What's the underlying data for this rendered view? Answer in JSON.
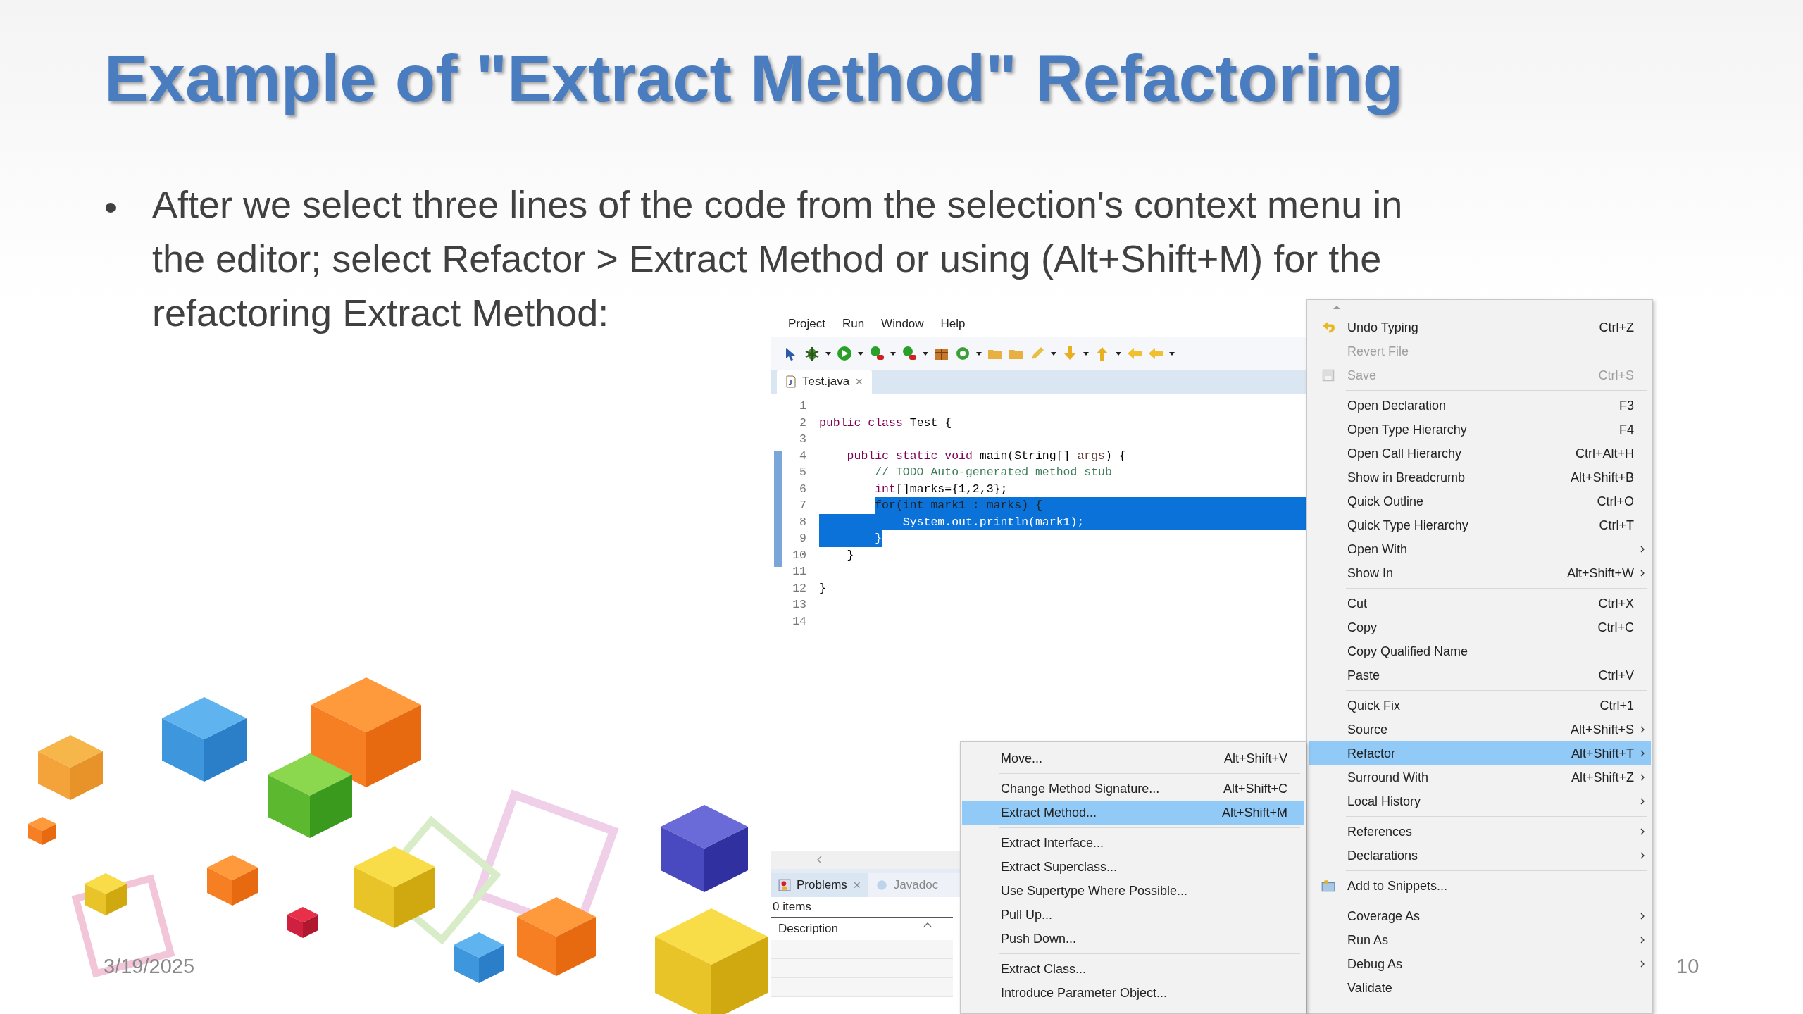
{
  "slide": {
    "title": "Example of \"Extract Method\" Refactoring",
    "bullet_lines": [
      "After we select three lines of the code from the selection's context menu in",
      "the editor; select Refactor > Extract Method or using (Alt+Shift+M) for the",
      "refactoring Extract Method:"
    ],
    "date": "3/19/2025",
    "page_number": "10"
  },
  "eclipse": {
    "menubar": [
      "Project",
      "Run",
      "Window",
      "Help"
    ],
    "editor_tab": {
      "label": "Test.java",
      "close": "✕"
    },
    "code_lines": [
      {
        "number": "1"
      },
      {
        "number": "2",
        "segments": [
          {
            "text": "public class",
            "kind": "keyword",
            "selected": false
          },
          {
            "text": " Test {",
            "kind": "plain",
            "selected": false
          }
        ]
      },
      {
        "number": "3"
      },
      {
        "number": "4",
        "segments": [
          {
            "text": "    public static void",
            "kind": "keyword",
            "selected": false
          },
          {
            "text": " main(String[] ",
            "kind": "plain",
            "selected": false
          },
          {
            "text": "args",
            "kind": "param",
            "selected": false
          },
          {
            "text": ") {",
            "kind": "plain",
            "selected": false
          }
        ]
      },
      {
        "number": "5",
        "segments": [
          {
            "text": "        // TODO Auto-generated method stub",
            "kind": "comment",
            "selected": false
          }
        ]
      },
      {
        "number": "6",
        "segments": [
          {
            "text": "        int",
            "kind": "keyword",
            "selected": false
          },
          {
            "text": "[]marks={1,2,3};",
            "kind": "plain",
            "selected": false
          }
        ]
      },
      {
        "number": "7",
        "selection_to_end": true,
        "indent_selected": false,
        "segments": [
          {
            "text": "        for(int mark1 : marks) {",
            "selected": true
          }
        ]
      },
      {
        "number": "8",
        "selection_to_end": true,
        "indent_selected": true,
        "segments": [
          {
            "text": "            System.out.println(mark1);",
            "selected": true
          }
        ]
      },
      {
        "number": "9",
        "selection_to_end": false,
        "indent_selected": true,
        "segments": [
          {
            "text": "        }",
            "selected": true
          }
        ]
      },
      {
        "number": "10",
        "segments": [
          {
            "text": "    }",
            "kind": "plain",
            "selected": false
          }
        ]
      },
      {
        "number": "11"
      },
      {
        "number": "12",
        "segments": [
          {
            "text": "}",
            "kind": "plain",
            "selected": false
          }
        ]
      },
      {
        "number": "13"
      },
      {
        "number": "14"
      }
    ],
    "bottom_panel": {
      "tabs": [
        {
          "label": "Problems",
          "selected": true
        },
        {
          "label": "Javadoc",
          "selected": false
        }
      ],
      "count": "0 items",
      "column": "Description"
    },
    "context_menu": [
      [
        {
          "label": "Undo Typing",
          "shortcut": "Ctrl+Z",
          "kind": "undo",
          "disabled": false,
          "selected": false,
          "submenu": false
        },
        {
          "label": "Revert File",
          "kind": "plain",
          "disabled": true,
          "selected": false,
          "submenu": false
        },
        {
          "label": "Save",
          "shortcut": "Ctrl+S",
          "kind": "save",
          "disabled": true,
          "selected": false,
          "submenu": false
        }
      ],
      [
        {
          "label": "Open Declaration",
          "shortcut": "F3",
          "kind": "plain",
          "disabled": false,
          "selected": false,
          "submenu": false
        },
        {
          "label": "Open Type Hierarchy",
          "shortcut": "F4",
          "kind": "plain",
          "disabled": false,
          "selected": false,
          "submenu": false
        },
        {
          "label": "Open Call Hierarchy",
          "shortcut": "Ctrl+Alt+H",
          "kind": "plain",
          "disabled": false,
          "selected": false,
          "submenu": false
        },
        {
          "label": "Show in Breadcrumb",
          "shortcut": "Alt+Shift+B",
          "kind": "plain",
          "disabled": false,
          "selected": false,
          "submenu": false
        },
        {
          "label": "Quick Outline",
          "shortcut": "Ctrl+O",
          "kind": "plain",
          "disabled": false,
          "selected": false,
          "submenu": false
        },
        {
          "label": "Quick Type Hierarchy",
          "shortcut": "Ctrl+T",
          "kind": "plain",
          "disabled": false,
          "selected": false,
          "submenu": false
        },
        {
          "label": "Open With",
          "kind": "plain",
          "disabled": false,
          "selected": false,
          "submenu": true
        },
        {
          "label": "Show In",
          "shortcut": "Alt+Shift+W",
          "kind": "plain",
          "disabled": false,
          "selected": false,
          "submenu": true
        }
      ],
      [
        {
          "label": "Cut",
          "shortcut": "Ctrl+X",
          "kind": "plain",
          "disabled": false,
          "selected": false,
          "submenu": false
        },
        {
          "label": "Copy",
          "shortcut": "Ctrl+C",
          "kind": "plain",
          "disabled": false,
          "selected": false,
          "submenu": false
        },
        {
          "label": "Copy Qualified Name",
          "kind": "plain",
          "disabled": false,
          "selected": false,
          "submenu": false
        },
        {
          "label": "Paste",
          "shortcut": "Ctrl+V",
          "kind": "plain",
          "disabled": false,
          "selected": false,
          "submenu": false
        }
      ],
      [
        {
          "label": "Quick Fix",
          "shortcut": "Ctrl+1",
          "kind": "plain",
          "disabled": false,
          "selected": false,
          "submenu": false
        },
        {
          "label": "Source",
          "shortcut": "Alt+Shift+S",
          "kind": "plain",
          "disabled": false,
          "selected": false,
          "submenu": true
        },
        {
          "label": "Refactor",
          "shortcut": "Alt+Shift+T",
          "kind": "plain",
          "disabled": false,
          "selected": true,
          "submenu": true
        },
        {
          "label": "Surround With",
          "shortcut": "Alt+Shift+Z",
          "kind": "plain",
          "disabled": false,
          "selected": false,
          "submenu": true
        },
        {
          "label": "Local History",
          "kind": "plain",
          "disabled": false,
          "selected": false,
          "submenu": true
        }
      ],
      [
        {
          "label": "References",
          "kind": "plain",
          "disabled": false,
          "selected": false,
          "submenu": true
        },
        {
          "label": "Declarations",
          "kind": "plain",
          "disabled": false,
          "selected": false,
          "submenu": true
        }
      ],
      [
        {
          "label": "Add to Snippets...",
          "kind": "snippet",
          "disabled": false,
          "selected": false,
          "submenu": false
        }
      ],
      [
        {
          "label": "Coverage As",
          "kind": "plain",
          "disabled": false,
          "selected": false,
          "submenu": true
        },
        {
          "label": "Run As",
          "kind": "plain",
          "disabled": false,
          "selected": false,
          "submenu": true
        },
        {
          "label": "Debug As",
          "kind": "plain",
          "disabled": false,
          "selected": false,
          "submenu": true
        },
        {
          "label": "Validate",
          "kind": "plain",
          "disabled": false,
          "selected": false,
          "submenu": false
        }
      ]
    ],
    "refactor_submenu": [
      [
        {
          "label": "Move...",
          "shortcut": "Alt+Shift+V",
          "selected": false
        }
      ],
      [
        {
          "label": "Change Method Signature...",
          "shortcut": "Alt+Shift+C",
          "selected": false
        },
        {
          "label": "Extract Method...",
          "shortcut": "Alt+Shift+M",
          "selected": true
        }
      ],
      [
        {
          "label": "Extract Interface...",
          "selected": false
        },
        {
          "label": "Extract Superclass...",
          "selected": false
        },
        {
          "label": "Use Supertype Where Possible...",
          "selected": false
        },
        {
          "label": "Pull Up...",
          "selected": false
        },
        {
          "label": "Push Down...",
          "selected": false
        }
      ],
      [
        {
          "label": "Extract Class...",
          "selected": false
        },
        {
          "label": "Introduce Parameter Object...",
          "selected": false
        }
      ]
    ]
  }
}
